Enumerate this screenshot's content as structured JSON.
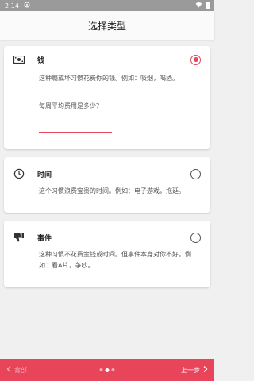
{
  "status_bar": {
    "time": "2:14",
    "icons": [
      "app-notification-icon",
      "wifi-icon",
      "battery-icon"
    ]
  },
  "header": {
    "title": "选择类型"
  },
  "options": [
    {
      "label": "钱",
      "description": "这种瘾或坏习惯花费你的钱。例如：吸烟，喝酒。",
      "icon": "money-icon",
      "selected": true,
      "question": "每周平均费用是多少？",
      "input_value": ""
    },
    {
      "label": "时间",
      "description": "这个习惯浪费宝贵的时间。例如：电子游戏，拖延。",
      "icon": "clock-icon",
      "selected": false
    },
    {
      "label": "事件",
      "description": "这种习惯不花费金钱或时间。但事件本身对你不好。例如：看A片，争吵。",
      "icon": "thumbs-down-icon",
      "selected": false
    }
  ],
  "bottom_bar": {
    "back_label": "背部",
    "next_label": "上一步",
    "pages": 3,
    "current_page": 2
  },
  "colors": {
    "accent": "#e8455a",
    "background": "#f0f0f0",
    "status_bar": "#9a9a9a"
  }
}
